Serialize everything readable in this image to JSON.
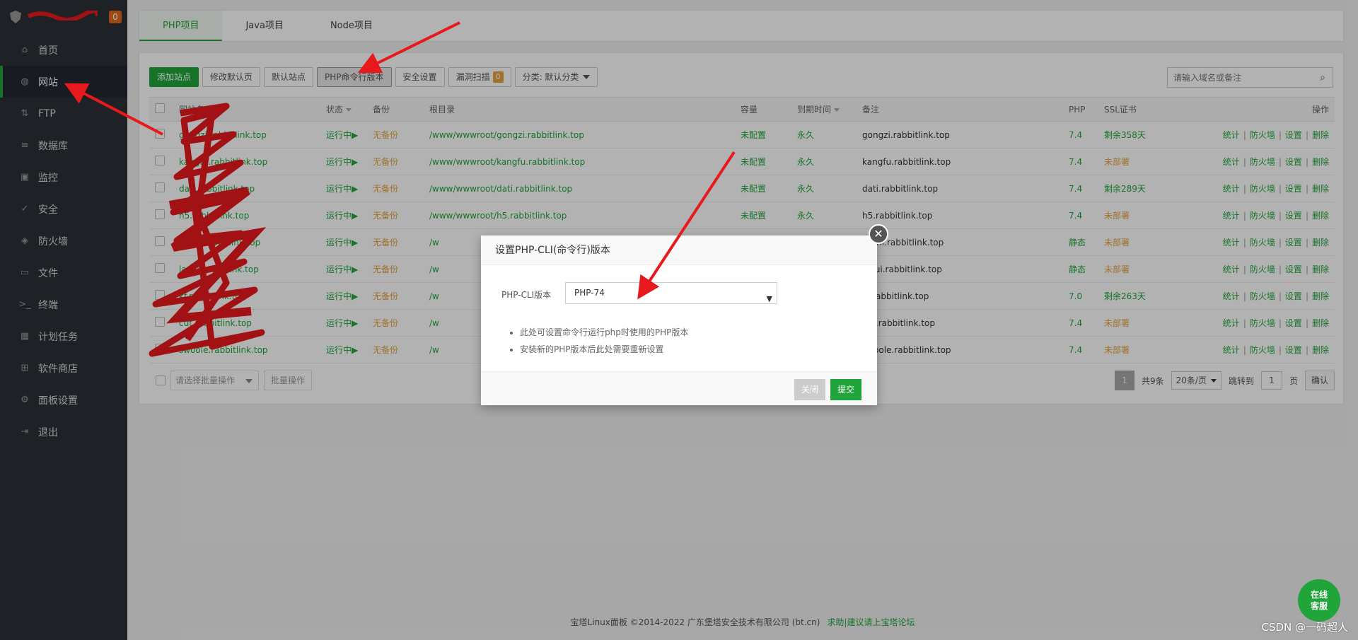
{
  "sidebar": {
    "badge": "0",
    "items": [
      {
        "label": "首页",
        "icon": "home-icon",
        "glyph": "⌂"
      },
      {
        "label": "网站",
        "icon": "globe-icon",
        "glyph": "◍"
      },
      {
        "label": "FTP",
        "icon": "ftp-icon",
        "glyph": "⇅"
      },
      {
        "label": "数据库",
        "icon": "database-icon",
        "glyph": "≡"
      },
      {
        "label": "监控",
        "icon": "monitor-icon",
        "glyph": "▣"
      },
      {
        "label": "安全",
        "icon": "shield-check-icon",
        "glyph": "✓"
      },
      {
        "label": "防火墙",
        "icon": "firewall-icon",
        "glyph": "◈"
      },
      {
        "label": "文件",
        "icon": "folder-icon",
        "glyph": "▭"
      },
      {
        "label": "终端",
        "icon": "terminal-icon",
        "glyph": ">_"
      },
      {
        "label": "计划任务",
        "icon": "calendar-icon",
        "glyph": "▦"
      },
      {
        "label": "软件商店",
        "icon": "apps-icon",
        "glyph": "⊞"
      },
      {
        "label": "面板设置",
        "icon": "settings-icon",
        "glyph": "⚙"
      },
      {
        "label": "退出",
        "icon": "logout-icon",
        "glyph": "⇥"
      }
    ]
  },
  "tabs": [
    "PHP项目",
    "Java项目",
    "Node项目"
  ],
  "toolbar": {
    "add_site": "添加站点",
    "edit_default": "修改默认页",
    "default_site": "默认站点",
    "php_cli": "PHP命令行版本",
    "security": "安全设置",
    "vuln_scan": "漏洞扫描",
    "vuln_count": "0",
    "category": "分类: 默认分类"
  },
  "search": {
    "placeholder": "请输入域名或备注"
  },
  "table": {
    "headers": {
      "site": "网站名",
      "status": "状态",
      "backup": "备份",
      "root": "根目录",
      "capacity": "容量",
      "expire": "到期时间",
      "remark": "备注",
      "php": "PHP",
      "ssl": "SSL证书",
      "ops": "操作"
    },
    "rows": [
      {
        "site": "gongzi.rabbitlink.top",
        "status": "运行中▶",
        "backup": "无备份",
        "root": "/www/wwwroot/gongzi.rabbitlink.top",
        "capacity": "未配置",
        "expire": "永久",
        "remark": "gongzi.rabbitlink.top",
        "php": "7.4",
        "ssl": "剩余358天",
        "ssl_ok": true
      },
      {
        "site": "kangfu.rabbitlink.top",
        "status": "运行中▶",
        "backup": "无备份",
        "root": "/www/wwwroot/kangfu.rabbitlink.top",
        "capacity": "未配置",
        "expire": "永久",
        "remark": "kangfu.rabbitlink.top",
        "php": "7.4",
        "ssl": "未部署",
        "ssl_ok": false
      },
      {
        "site": "dati.rabbitlink.top",
        "status": "运行中▶",
        "backup": "无备份",
        "root": "/www/wwwroot/dati.rabbitlink.top",
        "capacity": "未配置",
        "expire": "永久",
        "remark": "dati.rabbitlink.top",
        "php": "7.4",
        "ssl": "剩余289天",
        "ssl_ok": true
      },
      {
        "site": "h5.rabbitlink.top",
        "status": "运行中▶",
        "backup": "无备份",
        "root": "/www/wwwroot/h5.rabbitlink.top",
        "capacity": "未配置",
        "expire": "永久",
        "remark": "h5.rabbitlink.top",
        "php": "7.4",
        "ssl": "未部署",
        "ssl_ok": false
      },
      {
        "site": "ceshi.rabbitlink.top",
        "status": "运行中▶",
        "backup": "无备份",
        "root": "/w",
        "capacity": "",
        "expire": "",
        "remark": "ceshi.rabbitlink.top",
        "php": "静态",
        "ssl": "未部署",
        "ssl_ok": false
      },
      {
        "site": "layui.rabbitlink.top",
        "status": "运行中▶",
        "backup": "无备份",
        "root": "/w",
        "capacity": "",
        "expire": "",
        "remark": "layui.rabbitlink.top",
        "php": "静态",
        "ssl": "未部署",
        "ssl_ok": false
      },
      {
        "site": "kf.rabbitlink.top",
        "status": "运行中▶",
        "backup": "无备份",
        "root": "/w",
        "capacity": "",
        "expire": "",
        "remark": "kf.rabbitlink.top",
        "php": "7.0",
        "ssl": "剩余263天",
        "ssl_ok": true
      },
      {
        "site": "cut.rabbitlink.top",
        "status": "运行中▶",
        "backup": "无备份",
        "root": "/w",
        "capacity": "",
        "expire": "",
        "remark": "cut.rabbitlink.top",
        "php": "7.4",
        "ssl": "未部署",
        "ssl_ok": false
      },
      {
        "site": "swoole.rabbitlink.top",
        "status": "运行中▶",
        "backup": "无备份",
        "root": "/w",
        "capacity": "",
        "expire": "",
        "remark": "swoole.rabbitlink.top",
        "php": "7.4",
        "ssl": "未部署",
        "ssl_ok": false
      }
    ],
    "ops": [
      "统计",
      "防火墙",
      "设置",
      "删除"
    ]
  },
  "bottom": {
    "batch_placeholder": "请选择批量操作",
    "batch_button": "批量操作",
    "current_page": "1",
    "total": "共9条",
    "per_page": "20条/页",
    "goto_label": "跳转到",
    "goto_value": "1",
    "page_unit": "页",
    "confirm": "确认"
  },
  "modal": {
    "title": "设置PHP-CLI(命令行)版本",
    "label": "PHP-CLI版本",
    "selected": "PHP-74",
    "notes": [
      "此处可设置命令行运行php时使用的PHP版本",
      "安装新的PHP版本后此处需要重新设置"
    ],
    "close": "关闭",
    "submit": "提交"
  },
  "footer": {
    "copyright": "宝塔Linux面板 ©2014-2022 广东堡塔安全技术有限公司 (bt.cn)",
    "link": "求助|建议请上宝塔论坛"
  },
  "chat": {
    "line1": "在线",
    "line2": "客服"
  },
  "watermark": "CSDN @一码超人"
}
